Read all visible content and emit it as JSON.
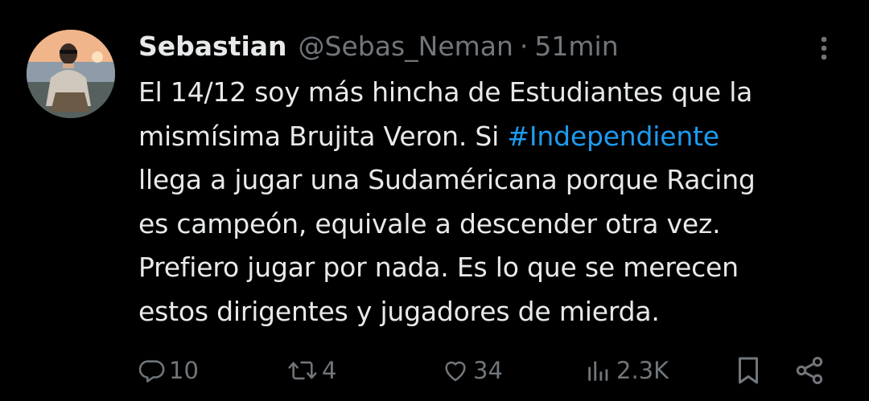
{
  "tweet": {
    "author_name": "Sebastian",
    "handle": "@Sebas_Neman",
    "separator": "·",
    "time": "51min",
    "text_lines": [
      "El 14/12 soy más hincha de Estudiantes que la",
      "mismísima Brujita Veron. Si ",
      "llega a jugar una Sudaméricana porque Racing",
      "es campeón, equivale a descender otra vez.",
      "Prefiero jugar por nada. Es lo que se merecen",
      "estos dirigentes y jugadores de mierda."
    ],
    "hashtag": "#Independiente",
    "actions": {
      "replies": "10",
      "retweets": "4",
      "likes": "34",
      "views": "2.3K"
    }
  },
  "icons": {
    "more": "more-vertical-icon",
    "reply": "reply-icon",
    "retweet": "retweet-icon",
    "like": "heart-icon",
    "views": "views-chart-icon",
    "bookmark": "bookmark-icon",
    "share": "share-icon"
  },
  "colors": {
    "background": "#000000",
    "text": "#e7e9ea",
    "muted": "#71767b",
    "link": "#1d9bf0"
  }
}
